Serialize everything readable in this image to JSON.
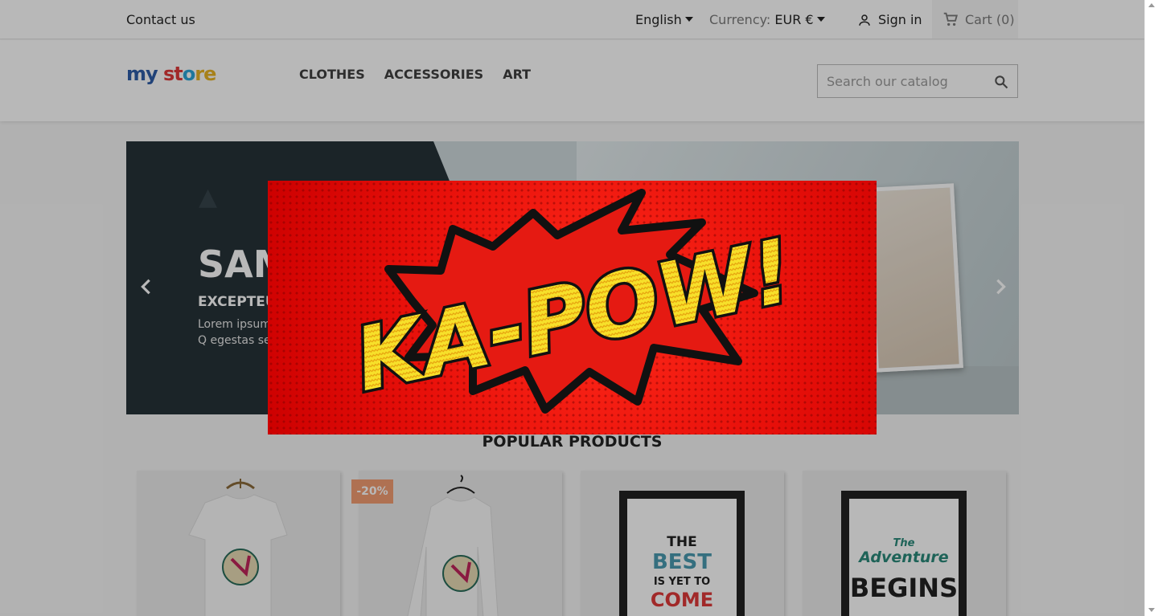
{
  "header": {
    "contact_label": "Contact us",
    "language_label": "English",
    "currency_label": "Currency:",
    "currency_value": "EUR €",
    "signin_label": "Sign in",
    "cart_label": "Cart (0)"
  },
  "store": {
    "logo_part1": "my",
    "logo_part2": " st",
    "logo_part3": "o",
    "logo_part4": "re"
  },
  "menu": {
    "items": [
      {
        "label": "CLOTHES"
      },
      {
        "label": "ACCESSORIES"
      },
      {
        "label": "ART"
      }
    ]
  },
  "search": {
    "placeholder": "Search our catalog"
  },
  "hero": {
    "title": "SAM",
    "subtitle": "EXCEPTEU",
    "description": "Lorem ipsum adipiscing el dignissim. Q egestas sem"
  },
  "section": {
    "popular_title": "POPULAR PRODUCTS"
  },
  "products": {
    "badge": "-20%",
    "poster3_line1": "THE",
    "poster3_line2": "BEST",
    "poster3_line3": "IS YET TO",
    "poster3_line4": "COME",
    "poster4_line1": "The",
    "poster4_line2": "Adventure",
    "poster4_line3": "BEGINS"
  },
  "modal": {
    "text": "KA-POW!"
  },
  "colors": {
    "modal_red": "#e8100a",
    "kapow_yellow": "#f7e02a",
    "badge": "#f39d72"
  }
}
